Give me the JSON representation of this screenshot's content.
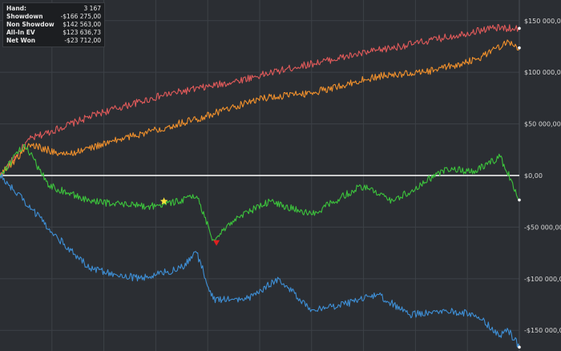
{
  "chart_data": {
    "type": "line",
    "title": "",
    "xlabel": "",
    "ylabel": "",
    "x_range": [
      0,
      3167
    ],
    "ylim": [
      -170000,
      170000
    ],
    "y_ticks": [
      {
        "value": 150000,
        "label": "$150 000,00"
      },
      {
        "value": 100000,
        "label": "$100 000,00"
      },
      {
        "value": 50000,
        "label": "$50 000,00"
      },
      {
        "value": 0,
        "label": "$0,00"
      },
      {
        "value": -50000,
        "label": "-$50 000,00"
      },
      {
        "value": -100000,
        "label": "-$100 000,00"
      },
      {
        "value": -150000,
        "label": "-$150 000,00"
      }
    ],
    "grid": true,
    "summary": [
      {
        "label": "Hand:",
        "value": "3 167"
      },
      {
        "label": "Showdown",
        "value": "-$166 275,00"
      },
      {
        "label": "Non Showdow",
        "value": "$142 563,00"
      },
      {
        "label": "All-In EV",
        "value": "$123 636,73"
      },
      {
        "label": "Net Won",
        "value": "-$23 712,00"
      }
    ],
    "series": [
      {
        "color": "#e05a5a",
        "x": [
          0,
          180,
          600,
          1000,
          1400,
          1800,
          2200,
          2600,
          3000,
          3167
        ],
        "values": [
          0,
          35000,
          60000,
          78000,
          90000,
          105000,
          118000,
          130000,
          143000,
          142563
        ]
      },
      {
        "color": "#f0902c",
        "x": [
          0,
          180,
          400,
          800,
          1200,
          1600,
          1900,
          2300,
          2600,
          2900,
          3100,
          3167
        ],
        "values": [
          0,
          30000,
          20000,
          38000,
          55000,
          75000,
          80000,
          96000,
          100000,
          112000,
          130000,
          123637
        ]
      },
      {
        "color": "#3cc43c",
        "x": [
          0,
          150,
          300,
          550,
          900,
          1000,
          1200,
          1300,
          1450,
          1650,
          1900,
          2200,
          2400,
          2700,
          2900,
          3050,
          3120,
          3167
        ],
        "values": [
          0,
          30000,
          -10000,
          -25000,
          -30000,
          -28000,
          -20000,
          -62000,
          -40000,
          -25000,
          -38000,
          -10000,
          -25000,
          5000,
          5000,
          18000,
          -5000,
          -23712
        ]
      },
      {
        "color": "#3e8fd6",
        "x": [
          0,
          150,
          350,
          550,
          850,
          1100,
          1200,
          1300,
          1500,
          1700,
          1900,
          2100,
          2300,
          2500,
          2700,
          2900,
          3050,
          3100,
          3167
        ],
        "values": [
          0,
          -25000,
          -60000,
          -90000,
          -100000,
          -90000,
          -75000,
          -120000,
          -120000,
          -100000,
          -130000,
          -125000,
          -115000,
          -135000,
          -130000,
          -135000,
          -155000,
          -150000,
          -166275
        ]
      }
    ],
    "markers": [
      {
        "x": 1000,
        "y": -25000,
        "shape": "star",
        "color": "#f7e23b"
      },
      {
        "x": 1320,
        "y": -65000,
        "shape": "triangle-down",
        "color": "#e02020"
      }
    ]
  }
}
